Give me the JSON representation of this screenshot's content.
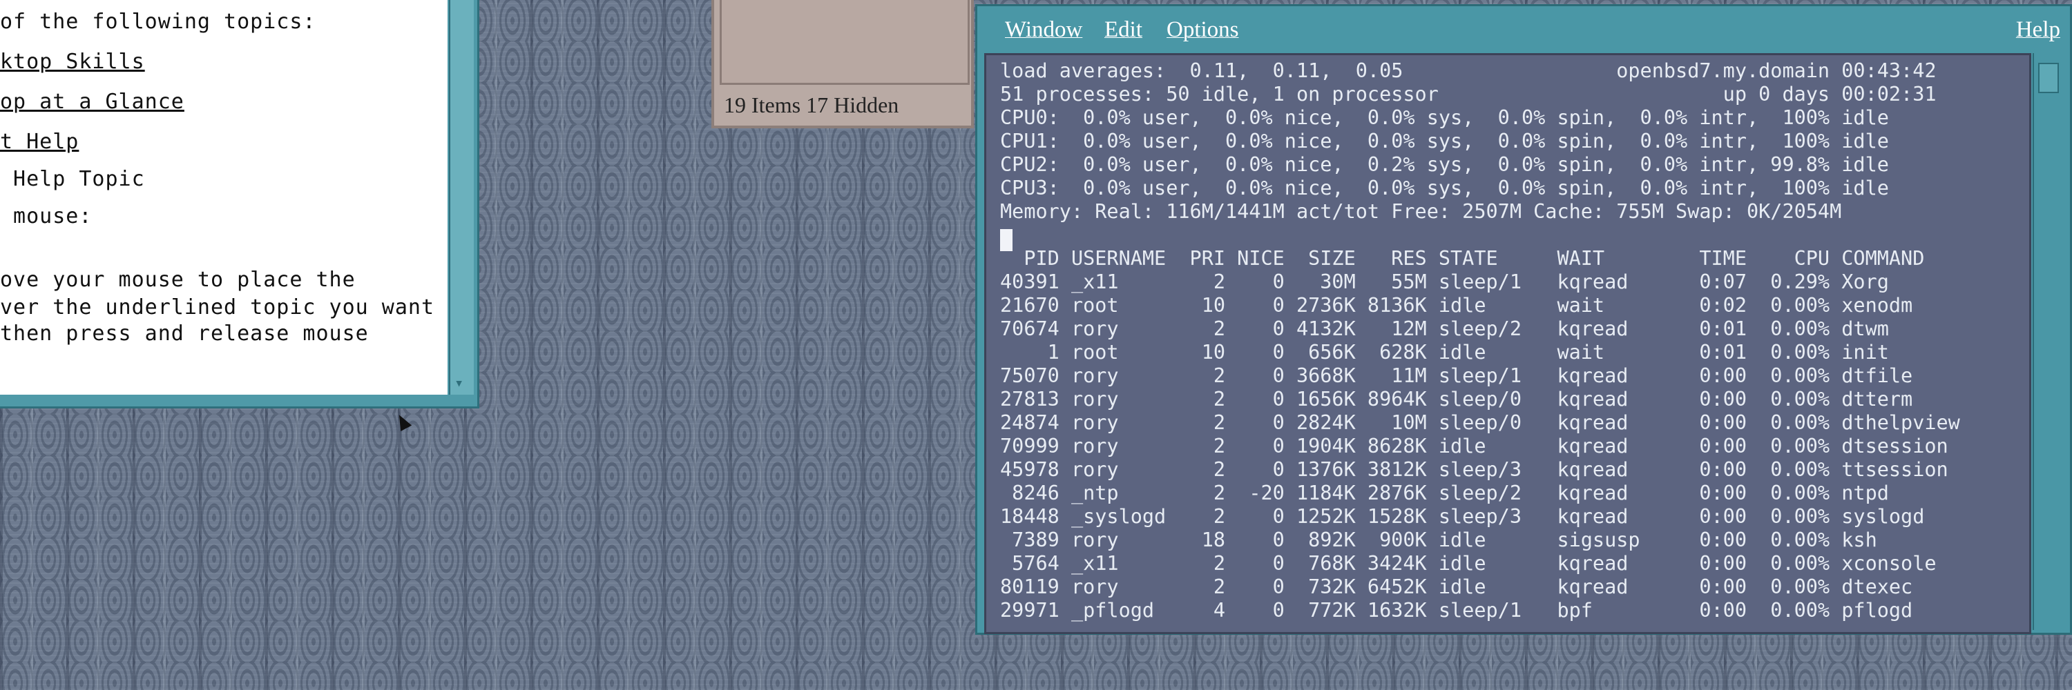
{
  "help_window": {
    "lines": [
      {
        "text": "of the following topics:",
        "link": false
      },
      {
        "text": "ktop Skills",
        "link": true
      },
      {
        "text": "op at a Glance",
        "link": true
      },
      {
        "text": "t Help",
        "link": true
      },
      {
        "text": " Help Topic",
        "link": false
      },
      {
        "text": " mouse:",
        "link": false
      },
      {
        "text": "",
        "link": false
      },
      {
        "text": "ove your mouse to place the",
        "link": false
      },
      {
        "text": "ver the underlined topic you want",
        "link": false
      },
      {
        "text": "then press and release mouse",
        "link": false
      }
    ]
  },
  "file_manager": {
    "status": "19 Items 17 Hidden"
  },
  "terminal": {
    "menu": {
      "window": "Window",
      "edit": "Edit",
      "options": "Options",
      "help": "Help"
    },
    "header_lines": [
      "load averages:  0.11,  0.11,  0.05                  openbsd7.my.domain 00:43:42",
      "51 processes: 50 idle, 1 on processor                        up 0 days 00:02:31",
      "CPU0:  0.0% user,  0.0% nice,  0.0% sys,  0.0% spin,  0.0% intr,  100% idle",
      "CPU1:  0.0% user,  0.0% nice,  0.0% sys,  0.0% spin,  0.0% intr,  100% idle",
      "CPU2:  0.0% user,  0.0% nice,  0.2% sys,  0.0% spin,  0.0% intr, 99.8% idle",
      "CPU3:  0.0% user,  0.0% nice,  0.0% sys,  0.0% spin,  0.0% intr,  100% idle",
      "Memory: Real: 116M/1441M act/tot Free: 2507M Cache: 755M Swap: 0K/2054M"
    ],
    "columns": [
      "PID",
      "USERNAME",
      "PRI",
      "NICE",
      "SIZE",
      "RES",
      "STATE",
      "WAIT",
      "TIME",
      "CPU",
      "COMMAND"
    ],
    "processes": [
      [
        "40391",
        "_x11",
        "2",
        "0",
        "30M",
        "55M",
        "sleep/1",
        "kqread",
        "0:07",
        "0.29%",
        "Xorg"
      ],
      [
        "21670",
        "root",
        "10",
        "0",
        "2736K",
        "8136K",
        "idle",
        "wait",
        "0:02",
        "0.00%",
        "xenodm"
      ],
      [
        "70674",
        "rory",
        "2",
        "0",
        "4132K",
        "12M",
        "sleep/2",
        "kqread",
        "0:01",
        "0.00%",
        "dtwm"
      ],
      [
        "1",
        "root",
        "10",
        "0",
        "656K",
        "628K",
        "idle",
        "wait",
        "0:01",
        "0.00%",
        "init"
      ],
      [
        "75070",
        "rory",
        "2",
        "0",
        "3668K",
        "11M",
        "sleep/1",
        "kqread",
        "0:00",
        "0.00%",
        "dtfile"
      ],
      [
        "27813",
        "rory",
        "2",
        "0",
        "1656K",
        "8964K",
        "sleep/0",
        "kqread",
        "0:00",
        "0.00%",
        "dtterm"
      ],
      [
        "24874",
        "rory",
        "2",
        "0",
        "2824K",
        "10M",
        "sleep/0",
        "kqread",
        "0:00",
        "0.00%",
        "dthelpview"
      ],
      [
        "70999",
        "rory",
        "2",
        "0",
        "1904K",
        "8628K",
        "idle",
        "kqread",
        "0:00",
        "0.00%",
        "dtsession"
      ],
      [
        "45978",
        "rory",
        "2",
        "0",
        "1376K",
        "3812K",
        "sleep/3",
        "kqread",
        "0:00",
        "0.00%",
        "ttsession"
      ],
      [
        "8246",
        "_ntp",
        "2",
        "-20",
        "1184K",
        "2876K",
        "sleep/2",
        "kqread",
        "0:00",
        "0.00%",
        "ntpd"
      ],
      [
        "18448",
        "_syslogd",
        "2",
        "0",
        "1252K",
        "1528K",
        "sleep/3",
        "kqread",
        "0:00",
        "0.00%",
        "syslogd"
      ],
      [
        "7389",
        "rory",
        "18",
        "0",
        "892K",
        "900K",
        "idle",
        "sigsusp",
        "0:00",
        "0.00%",
        "ksh"
      ],
      [
        "5764",
        "_x11",
        "2",
        "0",
        "768K",
        "3424K",
        "idle",
        "kqread",
        "0:00",
        "0.00%",
        "xconsole"
      ],
      [
        "80119",
        "rory",
        "2",
        "0",
        "732K",
        "6452K",
        "idle",
        "kqread",
        "0:00",
        "0.00%",
        "dtexec"
      ],
      [
        "29971",
        "_pflogd",
        "4",
        "0",
        "772K",
        "1632K",
        "sleep/1",
        "bpf",
        "0:00",
        "0.00%",
        "pflogd"
      ]
    ]
  }
}
